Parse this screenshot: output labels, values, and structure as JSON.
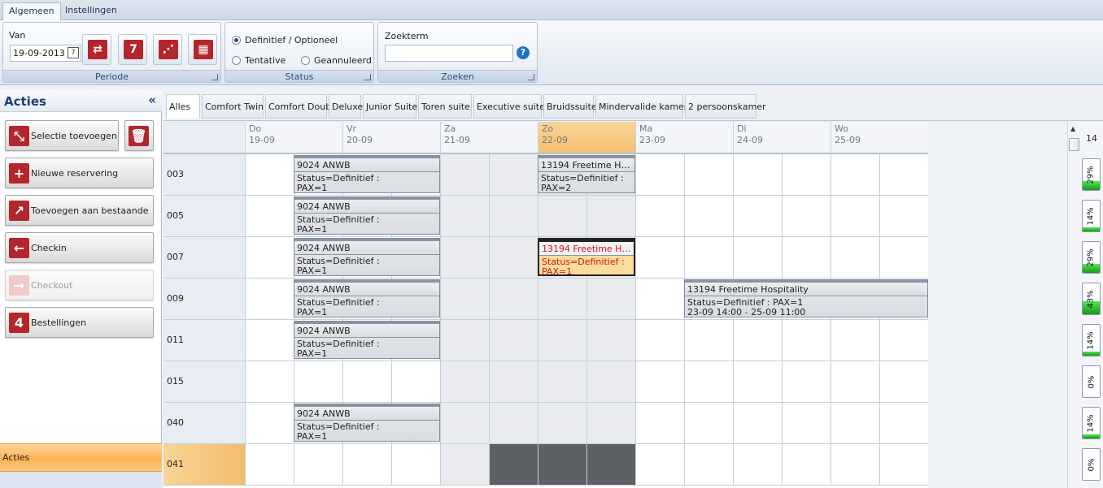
{
  "tabs": [
    {
      "label": "Algemeen",
      "active": true
    },
    {
      "label": "Instellingen",
      "active": false
    }
  ],
  "ribbon": {
    "periode": {
      "label": "Periode",
      "van_label": "Van",
      "date_value": "19-09-2013",
      "buttons": [
        {
          "name": "refresh-button",
          "icon": "refresh-icon",
          "glyph": "⇄"
        },
        {
          "name": "week-button",
          "icon": "seven-icon",
          "glyph": "7"
        },
        {
          "name": "month-button",
          "icon": "dots-icon",
          "glyph": "⋰"
        },
        {
          "name": "grid-button",
          "icon": "grid-icon",
          "glyph": "▦"
        }
      ]
    },
    "status": {
      "label": "Status",
      "options": [
        {
          "label": "Definitief / Optioneel",
          "checked": true
        },
        {
          "label": "Tentative",
          "checked": false
        },
        {
          "label": "Geannuleerd",
          "checked": false
        }
      ]
    },
    "zoeken": {
      "label": "Zoeken",
      "field_label": "Zoekterm",
      "value": "",
      "help": "?"
    }
  },
  "sidebar": {
    "title": "Acties",
    "collapse": "«",
    "actions": [
      {
        "label": "Selectie toevoegen",
        "icon": "add-selection-icon",
        "glyph": "⤡",
        "enabled": true
      },
      {
        "label": "Nieuwe reservering",
        "icon": "plus-icon",
        "glyph": "+",
        "enabled": true
      },
      {
        "label": "Toevoegen aan bestaande",
        "icon": "arrow-up-right-icon",
        "glyph": "↗",
        "enabled": true
      },
      {
        "label": "Checkin",
        "icon": "arrow-left-icon",
        "glyph": "←",
        "enabled": true
      },
      {
        "label": "Checkout",
        "icon": "arrow-right-icon",
        "glyph": "→",
        "enabled": false
      },
      {
        "label": "Bestellingen",
        "icon": "four-icon",
        "glyph": "4",
        "enabled": true
      }
    ],
    "delete_icon": "trash-icon",
    "footer_label": "Acties"
  },
  "room_tabs": [
    "Alles",
    "Comfort Twin",
    "Comfort Double",
    "Deluxe",
    "Junior Suite",
    "Toren suite",
    "Executive suite",
    "Bruidssuite",
    "Mindervalide kamer",
    "2 persoonskamer"
  ],
  "days": [
    {
      "dow": "Do",
      "date": "19-09",
      "weekend": false,
      "highlight": false
    },
    {
      "dow": "Vr",
      "date": "20-09",
      "weekend": false,
      "highlight": false
    },
    {
      "dow": "Za",
      "date": "21-09",
      "weekend": true,
      "highlight": false
    },
    {
      "dow": "Zo",
      "date": "22-09",
      "weekend": true,
      "highlight": true
    },
    {
      "dow": "Ma",
      "date": "23-09",
      "weekend": false,
      "highlight": false
    },
    {
      "dow": "Di",
      "date": "24-09",
      "weekend": false,
      "highlight": false
    },
    {
      "dow": "Wo",
      "date": "25-09",
      "weekend": false,
      "highlight": false
    }
  ],
  "rooms": [
    "003",
    "005",
    "007",
    "009",
    "011",
    "015",
    "040",
    "041"
  ],
  "highlight_room": "041",
  "blocked_cells": [
    {
      "room": "041",
      "day": "Zo"
    }
  ],
  "bookings": [
    {
      "room": "003",
      "start_day": "Do",
      "start_half": 1,
      "end_day": "Vr",
      "end_half": 1,
      "title": "9024 ANWB",
      "lines": [
        "Status=Definitief :",
        "PAX=1"
      ],
      "selected": false
    },
    {
      "room": "003",
      "start_day": "Zo",
      "start_half": 0,
      "end_day": "Zo",
      "end_half": 1,
      "title": "13194 Freetime Hos...",
      "lines": [
        "Status=Definitief :",
        "PAX=2"
      ],
      "selected": false
    },
    {
      "room": "005",
      "start_day": "Do",
      "start_half": 1,
      "end_day": "Vr",
      "end_half": 1,
      "title": "9024 ANWB",
      "lines": [
        "Status=Definitief :",
        "PAX=1"
      ],
      "selected": false
    },
    {
      "room": "007",
      "start_day": "Do",
      "start_half": 1,
      "end_day": "Vr",
      "end_half": 1,
      "title": "9024 ANWB",
      "lines": [
        "Status=Definitief :",
        "PAX=1"
      ],
      "selected": false
    },
    {
      "room": "007",
      "start_day": "Zo",
      "start_half": 0,
      "end_day": "Zo",
      "end_half": 1,
      "title": "13194 Freetime Hos...",
      "lines": [
        "Status=Definitief :",
        "PAX=1"
      ],
      "selected": true
    },
    {
      "room": "009",
      "start_day": "Do",
      "start_half": 1,
      "end_day": "Vr",
      "end_half": 1,
      "title": "9024 ANWB",
      "lines": [
        "Status=Definitief :",
        "PAX=1"
      ],
      "selected": false
    },
    {
      "room": "009",
      "start_day": "Ma",
      "start_half": 1,
      "end_day": "Wo",
      "end_half": 1,
      "title": "13194 Freetime Hospitality",
      "lines": [
        "Status=Definitief : PAX=1",
        "23-09 14:00 - 25-09 11:00"
      ],
      "selected": false
    },
    {
      "room": "011",
      "start_day": "Do",
      "start_half": 1,
      "end_day": "Vr",
      "end_half": 1,
      "title": "9024 ANWB",
      "lines": [
        "Status=Definitief :",
        "PAX=1"
      ],
      "selected": false
    },
    {
      "room": "040",
      "start_day": "Do",
      "start_half": 1,
      "end_day": "Vr",
      "end_half": 1,
      "title": "9024 ANWB",
      "lines": [
        "Status=Definitief :",
        "PAX=1"
      ],
      "selected": false
    }
  ],
  "occupancy": {
    "count": "14",
    "values": [
      {
        "label": "29%",
        "fraction": 0.29
      },
      {
        "label": "14%",
        "fraction": 0.14
      },
      {
        "label": "29%",
        "fraction": 0.29
      },
      {
        "label": "43%",
        "fraction": 0.43
      },
      {
        "label": "14%",
        "fraction": 0.14
      },
      {
        "label": "0%",
        "fraction": 0
      },
      {
        "label": "14%",
        "fraction": 0.14
      },
      {
        "label": "0%",
        "fraction": 0
      }
    ]
  },
  "colors": {
    "accent": "#b3262b",
    "highlight": "#f5c072",
    "selected_text": "#d1121b",
    "blocked": "#5d6064"
  }
}
